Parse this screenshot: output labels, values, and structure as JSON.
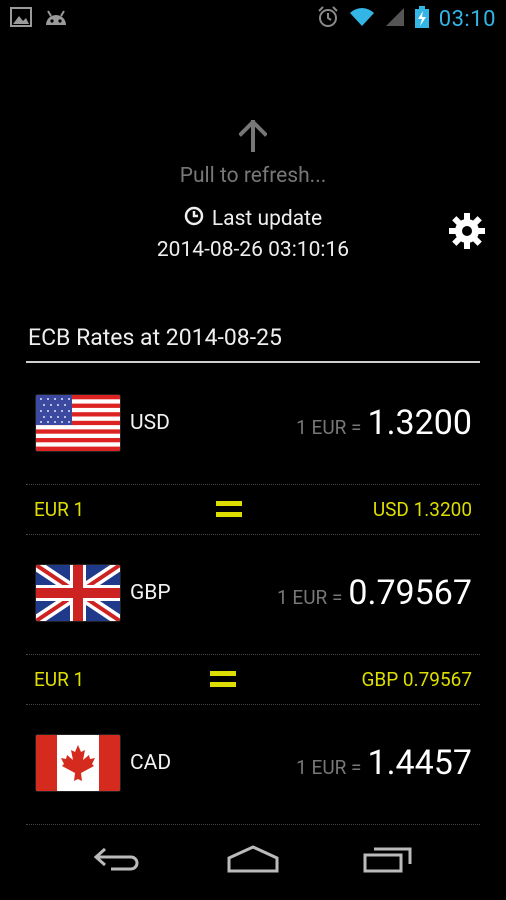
{
  "status_bar": {
    "time": "03:10",
    "left_icons": [
      "image-icon",
      "android-icon"
    ],
    "right_icons": [
      "alarm-icon",
      "wifi-icon",
      "signal-icon",
      "battery-charging-icon"
    ]
  },
  "pull_to_refresh": {
    "text": "Pull to refresh...",
    "arrow_icon": "arrow-up-icon"
  },
  "last_update": {
    "label": "Last update",
    "datetime": "2014-08-26 03:10:16",
    "icon": "clock-icon"
  },
  "settings_icon": "gear-icon",
  "section_title": "ECB Rates at 2014-08-25",
  "colors": {
    "accent_blue": "#33b5e5",
    "conversion_yellow": "#dddd00",
    "gray_text": "#777777",
    "background": "#000000"
  },
  "rates": [
    {
      "code": "USD",
      "flag": "us-flag-icon",
      "prefix": "1 EUR =",
      "value": "1.3200",
      "conv_left": "EUR 1",
      "conv_right": "USD 1.3200"
    },
    {
      "code": "GBP",
      "flag": "uk-flag-icon",
      "prefix": "1 EUR =",
      "value": "0.79567",
      "conv_left": "EUR 1",
      "conv_right": "GBP 0.79567"
    },
    {
      "code": "CAD",
      "flag": "canada-flag-icon",
      "prefix": "1 EUR =",
      "value": "1.4457"
    }
  ],
  "nav_bar": [
    "back-icon",
    "home-icon",
    "recent-apps-icon"
  ]
}
